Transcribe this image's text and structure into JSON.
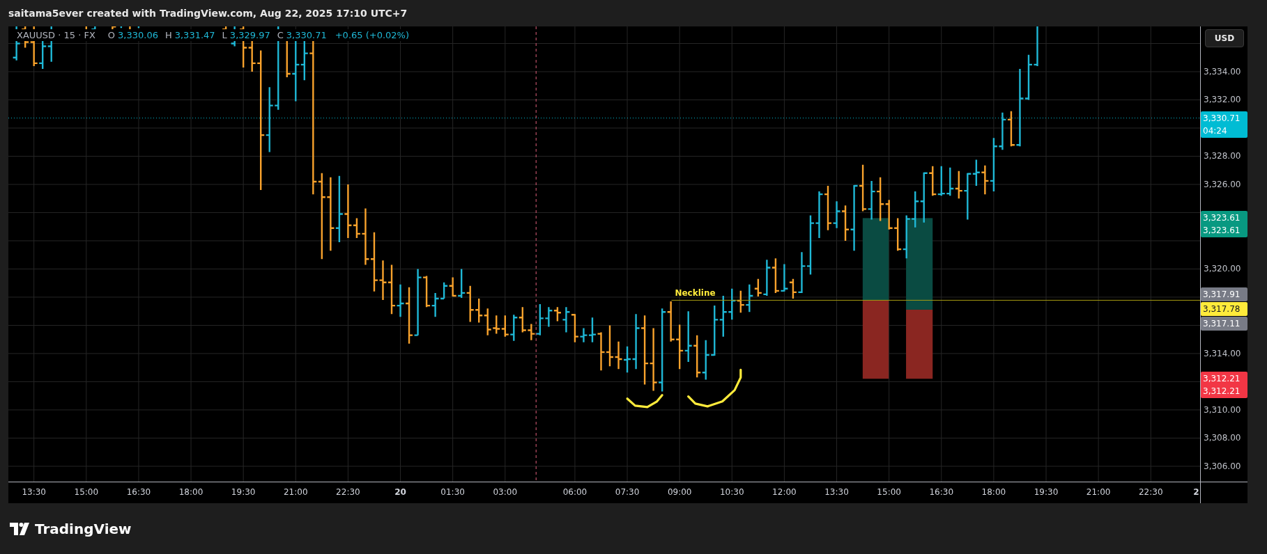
{
  "header": {
    "text": "saitama5ever created with TradingView.com, Aug 22, 2025 17:10 UTC+7"
  },
  "legend": {
    "symbol": "XAUUSD · 15 · FX",
    "values": [
      {
        "label": "O",
        "value": "3,330.06"
      },
      {
        "label": "H",
        "value": "3,331.47"
      },
      {
        "label": "L",
        "value": "3,329.97"
      },
      {
        "label": "C",
        "value": "3,330.71"
      }
    ],
    "change": "+0.65 (+0.02%)"
  },
  "chart": {
    "neckline_label": "Neckline",
    "time_labels": [
      {
        "text": "13:30",
        "kind": "time"
      },
      {
        "text": "15:00",
        "kind": "time"
      },
      {
        "text": "16:30",
        "kind": "time"
      },
      {
        "text": "18:00",
        "kind": "time"
      },
      {
        "text": "19:30",
        "kind": "time"
      },
      {
        "text": "21:00",
        "kind": "time"
      },
      {
        "text": "22:30",
        "kind": "time"
      },
      {
        "text": "20",
        "kind": "day"
      },
      {
        "text": "01:30",
        "kind": "time"
      },
      {
        "text": "03:00",
        "kind": "time"
      },
      {
        "text": "06:00",
        "kind": "time"
      },
      {
        "text": "07:30",
        "kind": "time"
      },
      {
        "text": "09:00",
        "kind": "time"
      },
      {
        "text": "10:30",
        "kind": "time"
      },
      {
        "text": "12:00",
        "kind": "time"
      },
      {
        "text": "13:30",
        "kind": "time"
      },
      {
        "text": "15:00",
        "kind": "time"
      },
      {
        "text": "16:30",
        "kind": "time"
      },
      {
        "text": "18:00",
        "kind": "time"
      },
      {
        "text": "19:30",
        "kind": "time"
      },
      {
        "text": "21:00",
        "kind": "time"
      },
      {
        "text": "22:30",
        "kind": "time"
      },
      {
        "text": "2",
        "kind": "day"
      }
    ],
    "price_labels": [
      "3,334.00",
      "3,332.00",
      "3,328.00",
      "3,326.00",
      "3,320.00",
      "3,314.00",
      "3,310.00",
      "3,308.00",
      "3,306.00"
    ],
    "price_tags": [
      {
        "lines": [
          "3,330.71",
          "04:24"
        ],
        "color": "#00bcd4"
      },
      {
        "lines": [
          "3,323.61",
          "3,323.61"
        ],
        "color": "#089981"
      },
      {
        "lines": [
          "3,317.91"
        ],
        "color": "#787b86"
      },
      {
        "lines": [
          "3,317.78"
        ],
        "color": "#ffeb3b"
      },
      {
        "lines": [
          "3,317.11"
        ],
        "color": "#787b86"
      },
      {
        "lines": [
          "3,312.21",
          "3,312.21"
        ],
        "color": "#f23645"
      }
    ]
  },
  "price_axis": {
    "currency": "USD"
  },
  "footer": {
    "brand": "TradingView"
  }
}
